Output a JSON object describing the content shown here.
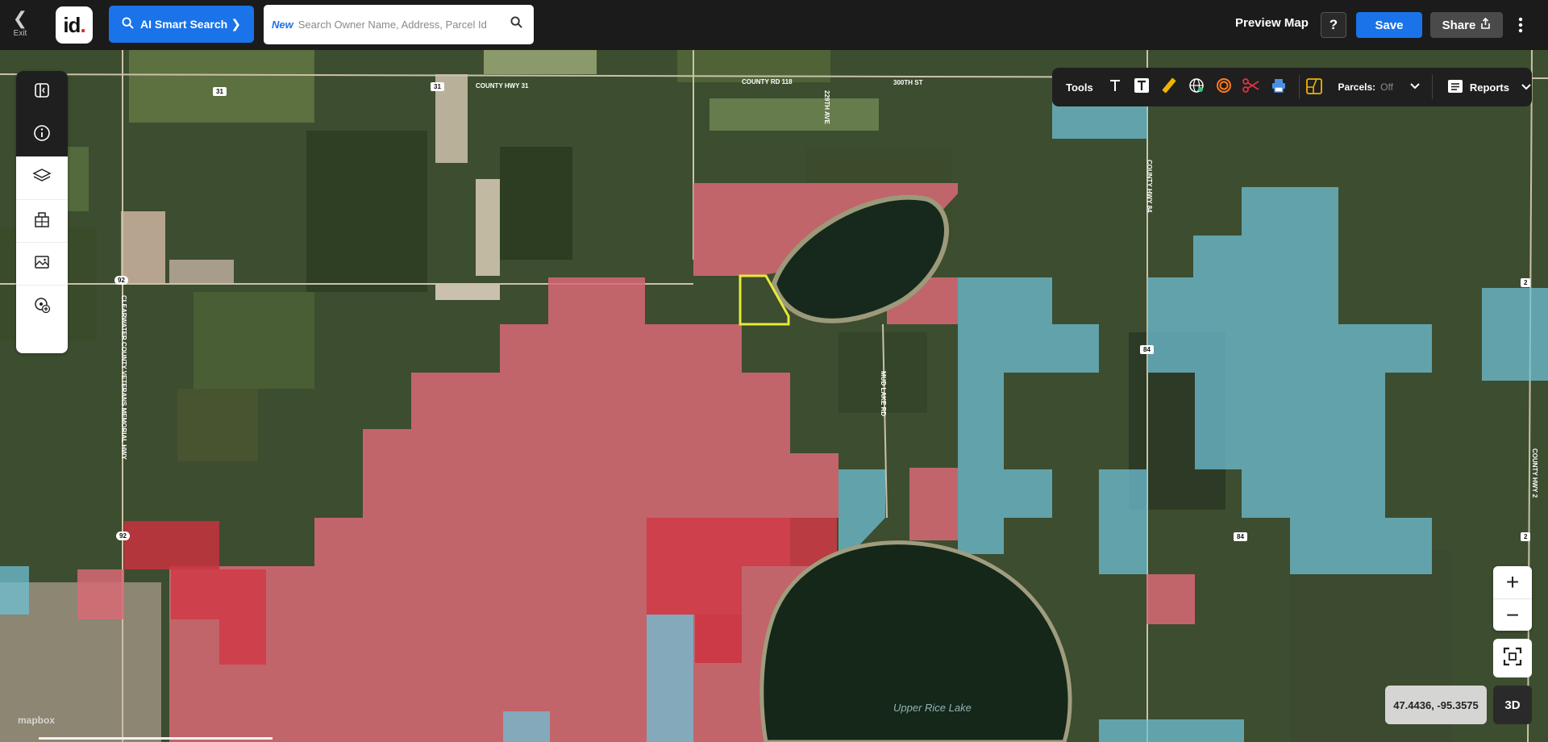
{
  "topbar": {
    "exit_label": "Exit",
    "logo_text": "id",
    "logo_dot": ".",
    "ai_search_label": "AI Smart Search",
    "search_badge": "New",
    "search_placeholder": "Search Owner Name, Address, Parcel Id",
    "preview_map_label": "Preview Map",
    "help_label": "?",
    "save_label": "Save",
    "share_label": "Share",
    "colors": {
      "primary": "#1a73e8",
      "bar_bg": "#1b1b1b"
    }
  },
  "left_toolbar": {
    "items": [
      {
        "icon": "sidebar-toggle-icon"
      },
      {
        "icon": "info-icon"
      },
      {
        "icon": "layers-icon"
      },
      {
        "icon": "buildings-icon"
      },
      {
        "icon": "image-icon"
      },
      {
        "icon": "add-location-icon"
      }
    ]
  },
  "tools_panel": {
    "label": "Tools",
    "tools": [
      "text-icon",
      "text-box-icon",
      "ruler-icon",
      "globe-measure-icon",
      "radius-icon",
      "scissors-icon",
      "print-icon"
    ],
    "parcels_label": "Parcels:",
    "parcels_state": "Off",
    "reports_label": "Reports"
  },
  "map": {
    "road_labels": [
      "COUNTY HWY 31",
      "COUNTY RD 118",
      "229TH AVE",
      "300TH ST",
      "COUNTY HWY 84",
      "MUD LAKE RD",
      "CLEARWATER COUNTY VETERANS MEMORIAL HWY",
      "COUNTY HWY 2"
    ],
    "shields": [
      "31",
      "31",
      "92",
      "92",
      "84",
      "84",
      "2",
      "2"
    ],
    "lake_label": "Upper Rice Lake",
    "attribution": "mapbox",
    "colors": {
      "red_overlay": "#e05a6a",
      "blue_overlay": "#6fc0d6",
      "selected_parcel": "#e8e83a"
    }
  },
  "controls": {
    "zoom_in": "+",
    "zoom_out": "−",
    "coords": "47.4436, -95.3575",
    "three_d": "3D"
  }
}
